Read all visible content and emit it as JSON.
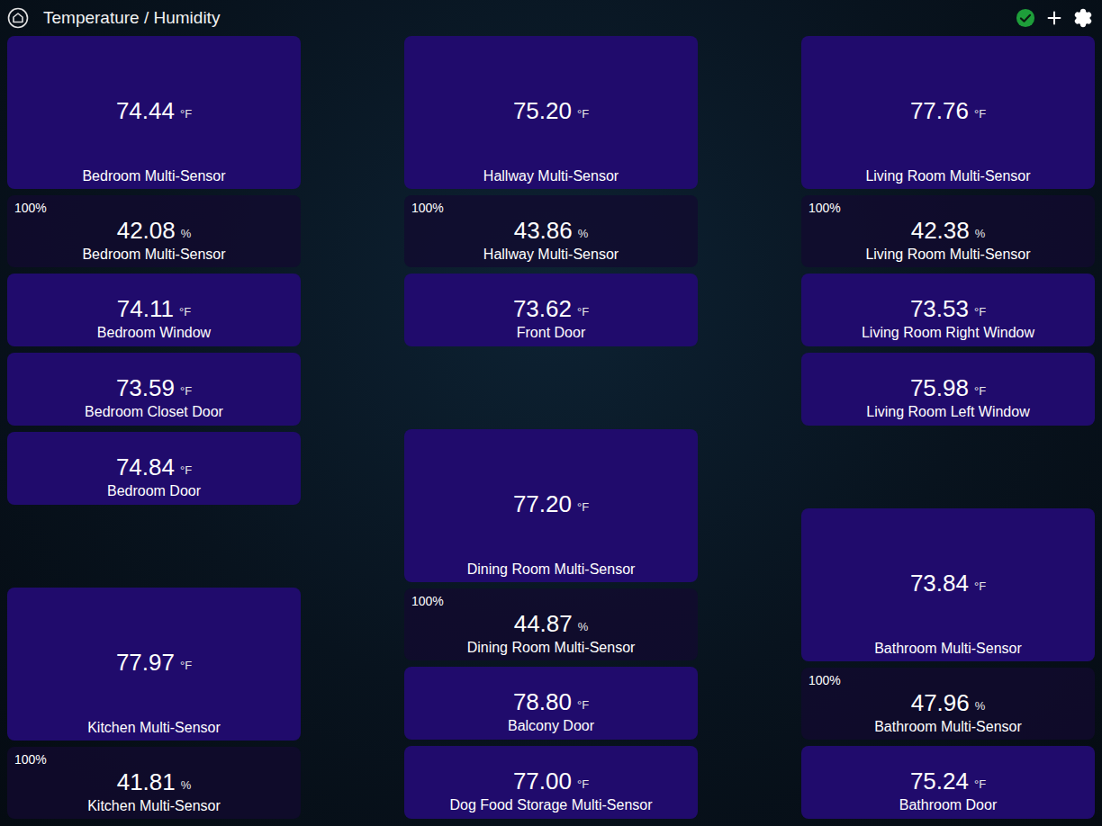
{
  "header": {
    "title": "Temperature / Humidity",
    "connected": true
  },
  "columns": [
    {
      "groups": [
        {
          "cards": [
            {
              "kind": "large",
              "value": "74.44",
              "unit": "°F",
              "name": "Bedroom Multi-Sensor"
            },
            {
              "kind": "humidity",
              "battery": "100%",
              "value": "42.08",
              "unit": "%",
              "name": "Bedroom Multi-Sensor"
            },
            {
              "kind": "small",
              "value": "74.11",
              "unit": "°F",
              "name": "Bedroom Window"
            },
            {
              "kind": "small",
              "value": "73.59",
              "unit": "°F",
              "name": "Bedroom Closet Door"
            },
            {
              "kind": "small",
              "value": "74.84",
              "unit": "°F",
              "name": "Bedroom Door"
            }
          ]
        },
        {
          "cards": [
            {
              "kind": "large",
              "value": "77.97",
              "unit": "°F",
              "name": "Kitchen Multi-Sensor"
            },
            {
              "kind": "humidity",
              "battery": "100%",
              "value": "41.81",
              "unit": "%",
              "name": "Kitchen Multi-Sensor"
            }
          ]
        }
      ]
    },
    {
      "groups": [
        {
          "cards": [
            {
              "kind": "large",
              "value": "75.20",
              "unit": "°F",
              "name": "Hallway Multi-Sensor"
            },
            {
              "kind": "humidity",
              "battery": "100%",
              "value": "43.86",
              "unit": "%",
              "name": "Hallway Multi-Sensor"
            },
            {
              "kind": "small",
              "value": "73.62",
              "unit": "°F",
              "name": "Front Door"
            }
          ]
        },
        {
          "cards": [
            {
              "kind": "large",
              "value": "77.20",
              "unit": "°F",
              "name": "Dining Room Multi-Sensor"
            },
            {
              "kind": "humidity",
              "battery": "100%",
              "value": "44.87",
              "unit": "%",
              "name": "Dining Room Multi-Sensor"
            },
            {
              "kind": "small",
              "value": "78.80",
              "unit": "°F",
              "name": "Balcony Door"
            },
            {
              "kind": "small",
              "value": "77.00",
              "unit": "°F",
              "name": "Dog Food Storage Multi-Sensor"
            }
          ]
        }
      ]
    },
    {
      "groups": [
        {
          "cards": [
            {
              "kind": "large",
              "value": "77.76",
              "unit": "°F",
              "name": "Living Room Multi-Sensor"
            },
            {
              "kind": "humidity",
              "battery": "100%",
              "value": "42.38",
              "unit": "%",
              "name": "Living Room Multi-Sensor"
            },
            {
              "kind": "small",
              "value": "73.53",
              "unit": "°F",
              "name": "Living Room Right Window"
            },
            {
              "kind": "small",
              "value": "75.98",
              "unit": "°F",
              "name": "Living Room Left Window"
            }
          ]
        },
        {
          "cards": [
            {
              "kind": "large",
              "value": "73.84",
              "unit": "°F",
              "name": "Bathroom Multi-Sensor"
            },
            {
              "kind": "humidity",
              "battery": "100%",
              "value": "47.96",
              "unit": "%",
              "name": "Bathroom Multi-Sensor"
            },
            {
              "kind": "small",
              "value": "75.24",
              "unit": "°F",
              "name": "Bathroom Door"
            }
          ]
        }
      ]
    }
  ]
}
